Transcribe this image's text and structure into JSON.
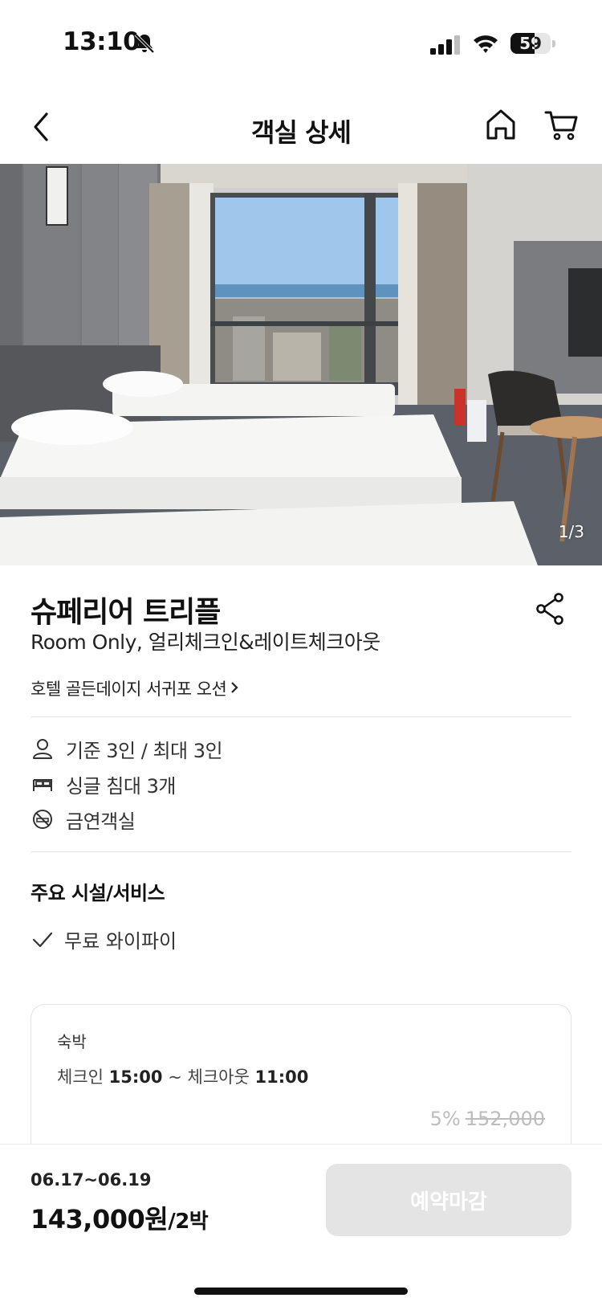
{
  "status_bar": {
    "time": "13:10",
    "battery": "59",
    "battery_level": 0.59,
    "icons": [
      "bell-off-icon",
      "signal-icon",
      "wifi-icon",
      "battery-icon"
    ]
  },
  "nav": {
    "title": "객실 상세",
    "icons": [
      "back-arrow-icon",
      "home-icon",
      "cart-icon"
    ]
  },
  "hero": {
    "counter": "1/3"
  },
  "room": {
    "name": "슈페리어 트리플",
    "subtitle": "Room Only, 얼리체크인&레이트체크아웃",
    "hotel_link": "호텔 골든데이지 서귀포 오션",
    "specs": [
      {
        "icon": "person-icon",
        "text": "기준 3인 / 최대 3인"
      },
      {
        "icon": "bed-icon",
        "text": "싱글 침대 3개"
      },
      {
        "icon": "no-smoking-icon",
        "text": "금연객실"
      }
    ]
  },
  "amenities": {
    "title": "주요 시설/서비스",
    "items": [
      "무료 와이파이"
    ]
  },
  "stay": {
    "label": "숙박",
    "checkin_label": "체크인",
    "checkin_time": "15:00",
    "separator": "~",
    "checkout_label": "체크아웃",
    "checkout_time": "11:00",
    "discount_rate": "5%",
    "original_price": "152,000"
  },
  "bottom": {
    "dates": "06.17~06.19",
    "price": "143,000원",
    "nights": "/2박",
    "button_label": "예약마감"
  }
}
